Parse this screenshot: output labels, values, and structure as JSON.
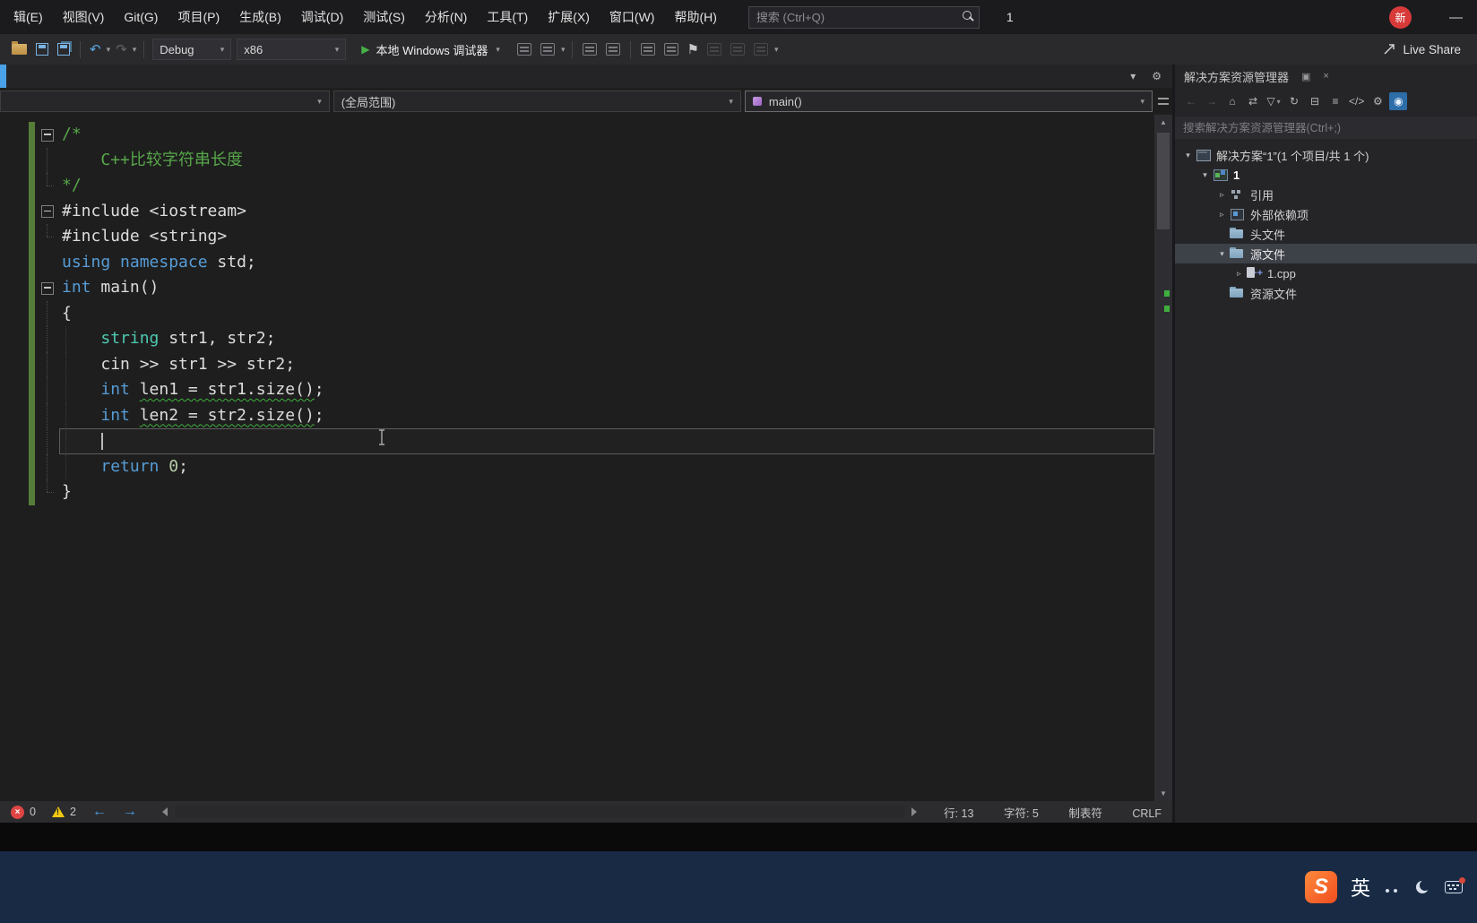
{
  "window": {
    "title_fragment": "1",
    "badge": "新"
  },
  "menu_bar": {
    "items": [
      "辑(E)",
      "视图(V)",
      "Git(G)",
      "项目(P)",
      "生成(B)",
      "调试(D)",
      "测试(S)",
      "分析(N)",
      "工具(T)",
      "扩展(X)",
      "窗口(W)",
      "帮助(H)"
    ],
    "search_placeholder": "搜索 (Ctrl+Q)"
  },
  "toolbar": {
    "configuration": "Debug",
    "platform": "x86",
    "start_label": "本地 Windows 调试器",
    "live_share_label": "Live Share"
  },
  "navbar": {
    "project_dropdown": "",
    "scope_dropdown": "(全局范围)",
    "member_dropdown": "main()"
  },
  "editor": {
    "lines": [
      {
        "fold": "box",
        "guide": false,
        "current": false,
        "segs": [
          {
            "t": "/*",
            "c": "cm"
          }
        ]
      },
      {
        "fold": "vline",
        "guide": false,
        "current": false,
        "segs": [
          {
            "t": "\tC++比较字符串长度",
            "c": "cm"
          }
        ]
      },
      {
        "fold": "lend",
        "guide": false,
        "current": false,
        "segs": [
          {
            "t": "*/",
            "c": "cm"
          }
        ]
      },
      {
        "fold": "box",
        "guide": false,
        "current": false,
        "segs": [
          {
            "t": "#include <iostream>",
            "c": "pl"
          }
        ]
      },
      {
        "fold": "lend",
        "guide": false,
        "current": false,
        "segs": [
          {
            "t": "#include <string>",
            "c": "pl"
          }
        ]
      },
      {
        "fold": "none",
        "guide": false,
        "current": false,
        "segs": [
          {
            "t": "using",
            "c": "kw"
          },
          {
            "t": " ",
            "c": "pl"
          },
          {
            "t": "namespace",
            "c": "kw"
          },
          {
            "t": " std;",
            "c": "pl"
          }
        ]
      },
      {
        "fold": "box",
        "guide": false,
        "current": false,
        "segs": [
          {
            "t": "int",
            "c": "kw"
          },
          {
            "t": " main()",
            "c": "pl"
          }
        ]
      },
      {
        "fold": "vline",
        "guide": false,
        "current": false,
        "segs": [
          {
            "t": "{",
            "c": "pl"
          }
        ]
      },
      {
        "fold": "vline",
        "guide": true,
        "current": false,
        "segs": [
          {
            "t": "\t",
            "c": "pl"
          },
          {
            "t": "string",
            "c": "ty"
          },
          {
            "t": " str1, str2;",
            "c": "pl"
          }
        ]
      },
      {
        "fold": "vline",
        "guide": true,
        "current": false,
        "segs": [
          {
            "t": "\tcin >> str1 >> str2;",
            "c": "pl"
          }
        ]
      },
      {
        "fold": "vline",
        "guide": true,
        "current": false,
        "segs": [
          {
            "t": "\t",
            "c": "pl"
          },
          {
            "t": "int",
            "c": "kw"
          },
          {
            "t": " ",
            "c": "pl"
          },
          {
            "t": "len1 = str1.size()",
            "c": "pl",
            "w": true
          },
          {
            "t": ";",
            "c": "pl"
          }
        ]
      },
      {
        "fold": "vline",
        "guide": true,
        "current": false,
        "segs": [
          {
            "t": "\t",
            "c": "pl"
          },
          {
            "t": "int",
            "c": "kw"
          },
          {
            "t": " ",
            "c": "pl"
          },
          {
            "t": "len2 = str2.size()",
            "c": "pl",
            "w": true
          },
          {
            "t": ";",
            "c": "pl"
          }
        ]
      },
      {
        "fold": "vline",
        "guide": true,
        "current": true,
        "segs": []
      },
      {
        "fold": "vline",
        "guide": true,
        "current": false,
        "segs": [
          {
            "t": "\t",
            "c": "pl"
          },
          {
            "t": "return",
            "c": "kw"
          },
          {
            "t": " ",
            "c": "pl"
          },
          {
            "t": "0",
            "c": "num"
          },
          {
            "t": ";",
            "c": "pl"
          }
        ]
      },
      {
        "fold": "lend",
        "guide": false,
        "current": false,
        "segs": [
          {
            "t": "}",
            "c": "pl"
          }
        ]
      }
    ]
  },
  "status_bar": {
    "errors": "0",
    "warnings": "2",
    "line": "行: 13",
    "column": "字符: 5",
    "indent": "制表符",
    "eol": "CRLF"
  },
  "explorer": {
    "title": "解决方案资源管理器",
    "search_placeholder": "搜索解决方案资源管理器(Ctrl+;)",
    "toolbar": [
      {
        "id": "back",
        "glyph": "←",
        "disabled": true
      },
      {
        "id": "forward",
        "glyph": "→",
        "disabled": true
      },
      {
        "id": "home",
        "glyph": "⌂",
        "disabled": false
      },
      {
        "id": "sync-active-document",
        "glyph": "⇄",
        "disabled": false
      },
      {
        "id": "pending-changes-filter",
        "glyph": "▽",
        "caret": true,
        "disabled": false
      },
      {
        "id": "refresh",
        "glyph": "↻",
        "disabled": false
      },
      {
        "id": "collapse-all",
        "glyph": "⊟",
        "disabled": false
      },
      {
        "id": "show-all-files",
        "glyph": "≡",
        "disabled": false
      },
      {
        "id": "code-view",
        "glyph": "</>",
        "disabled": false
      },
      {
        "id": "properties",
        "glyph": "⚙",
        "disabled": false
      },
      {
        "id": "preview-selected",
        "glyph": "◉",
        "active": true,
        "disabled": false
      }
    ],
    "tree": [
      {
        "id": "solution",
        "label": "解决方案“1”(1 个项目/共 1 个)",
        "depth": 0,
        "expander": "open",
        "icon": "solution",
        "selected": false,
        "bold": false
      },
      {
        "id": "project-1",
        "label": "1",
        "depth": 1,
        "expander": "open",
        "icon": "project",
        "selected": false,
        "bold": true
      },
      {
        "id": "references",
        "label": "引用",
        "depth": 2,
        "expander": "closed",
        "icon": "references",
        "selected": false,
        "bold": false
      },
      {
        "id": "external-dependencies",
        "label": "外部依赖项",
        "depth": 2,
        "expander": "closed",
        "icon": "dependencies",
        "selected": false,
        "bold": false
      },
      {
        "id": "header-files",
        "label": "头文件",
        "depth": 2,
        "expander": "none",
        "icon": "folder",
        "selected": false,
        "bold": false
      },
      {
        "id": "source-files",
        "label": "源文件",
        "depth": 2,
        "expander": "open",
        "icon": "folder",
        "selected": true,
        "bold": false
      },
      {
        "id": "1-cpp",
        "label": "1.cpp",
        "depth": 3,
        "expander": "closed",
        "icon": "cpp",
        "selected": false,
        "bold": false
      },
      {
        "id": "resource-files",
        "label": "资源文件",
        "depth": 2,
        "expander": "none",
        "icon": "folder",
        "selected": false,
        "bold": false
      }
    ]
  },
  "taskbar": {
    "ime_logo": "S",
    "ime_mode": "英"
  },
  "icons": {
    "caret": "▾",
    "undo": "↶",
    "redo": "↷",
    "play": "▶",
    "bookmark": "⚑",
    "gear": "⚙",
    "arrow_up": "▲",
    "arrow_down": "▼",
    "minimize": "—",
    "close": "×",
    "dock": "▣",
    "cpp_glyph": "++",
    "expander_open": "▾",
    "expander_closed": "▹"
  },
  "colors": {
    "keyword_blue": "#569cd6",
    "comment_green": "#57a64a",
    "type_teal": "#4ec9b0",
    "number_green": "#b5cea8",
    "squiggle_green": "#3fae3f",
    "change_bar_green": "#567c39",
    "warning_yellow": "#f2c811",
    "error_red": "#df4543",
    "run_green": "#47b147",
    "accent_tab_blue": "#4aa3e8",
    "ime_orange": "#ef4d1f",
    "taskbar_navy": "#182a44"
  }
}
